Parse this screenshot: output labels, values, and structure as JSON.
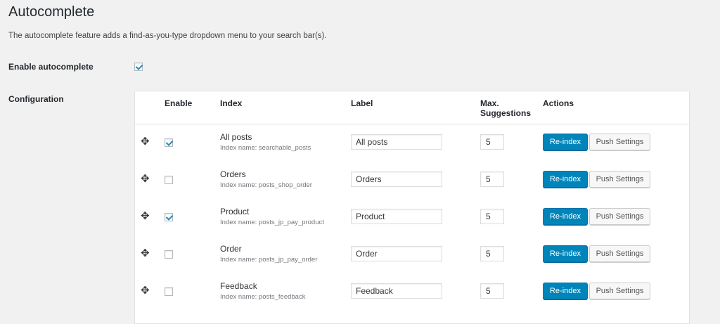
{
  "page": {
    "title": "Autocomplete",
    "description": "The autocomplete feature adds a find-as-you-type dropdown menu to your search bar(s)."
  },
  "enable_autocomplete": {
    "label": "Enable autocomplete",
    "checked": true
  },
  "configuration": {
    "label": "Configuration",
    "columns": {
      "enable": "Enable",
      "index": "Index",
      "label": "Label",
      "max_line1": "Max.",
      "max_line2": "Suggestions",
      "actions": "Actions"
    },
    "rows": [
      {
        "enabled": true,
        "index": "All posts",
        "index_name": "Index name: searchable_posts",
        "label": "All posts",
        "max": "5",
        "reindex": "Re-index",
        "push": "Push Settings"
      },
      {
        "enabled": false,
        "index": "Orders",
        "index_name": "Index name: posts_shop_order",
        "label": "Orders",
        "max": "5",
        "reindex": "Re-index",
        "push": "Push Settings"
      },
      {
        "enabled": true,
        "index": "Product",
        "index_name": "Index name: posts_jp_pay_product",
        "label": "Product",
        "max": "5",
        "reindex": "Re-index",
        "push": "Push Settings"
      },
      {
        "enabled": false,
        "index": "Order",
        "index_name": "Index name: posts_jp_pay_order",
        "label": "Order",
        "max": "5",
        "reindex": "Re-index",
        "push": "Push Settings"
      },
      {
        "enabled": false,
        "index": "Feedback",
        "index_name": "Index name: posts_feedback",
        "label": "Feedback",
        "max": "5",
        "reindex": "Re-index",
        "push": "Push Settings"
      }
    ]
  },
  "icons": {
    "drag": "move-handle-icon",
    "check": "checkmark-icon"
  },
  "colors": {
    "primary_button": "#0085ba",
    "checkmark": "#1e8cbe",
    "background": "#f1f1f1"
  }
}
